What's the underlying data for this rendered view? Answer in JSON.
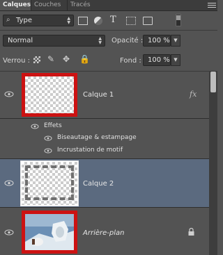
{
  "tabs": [
    {
      "label": "Calques",
      "active": true
    },
    {
      "label": "Couches",
      "active": false
    },
    {
      "label": "Tracés",
      "active": false
    }
  ],
  "filter": {
    "kind_label": "Type",
    "icons": [
      "image-filter-icon",
      "adjustment-filter-icon",
      "type-filter-icon",
      "shape-filter-icon",
      "smart-object-filter-icon",
      "filter-toggle-icon"
    ]
  },
  "blend": {
    "mode": "Normal",
    "opacity_label": "Opacité :",
    "opacity_value": "100 %"
  },
  "lock": {
    "label": "Verrou :",
    "fill_label": "Fond :",
    "fill_value": "100 %",
    "icons": [
      "lock-transparency-icon",
      "lock-paint-icon",
      "lock-position-icon",
      "lock-all-icon"
    ]
  },
  "layers": [
    {
      "name": "Calque 1",
      "fx": "fx",
      "effects_label": "Effets",
      "effects": [
        "Biseautage & estampage",
        "Incrustation de motif"
      ]
    },
    {
      "name": "Calque 2",
      "selected": true
    },
    {
      "name": "Arrière-plan",
      "locked": true,
      "italic": true
    }
  ],
  "colors": {
    "panel": "#535353",
    "selected": "#5b6a7f",
    "accent_red": "#cc1212"
  }
}
